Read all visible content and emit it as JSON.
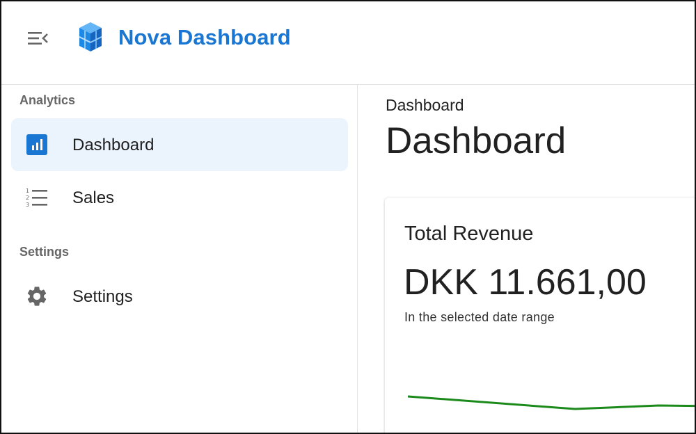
{
  "header": {
    "app_title": "Nova Dashboard",
    "menu_icon": "menu-open-icon",
    "logo_icon": "stacked-blocks-logo",
    "brand_color": "#1976d2"
  },
  "sidebar": {
    "sections": [
      {
        "title": "Analytics",
        "items": [
          {
            "label": "Dashboard",
            "icon": "bar-chart-icon",
            "active": true
          },
          {
            "label": "Sales",
            "icon": "numbered-list-icon",
            "active": false
          }
        ]
      },
      {
        "title": "Settings",
        "items": [
          {
            "label": "Settings",
            "icon": "gear-icon",
            "active": false
          }
        ]
      }
    ],
    "active_bg": "#ebf3fc"
  },
  "main": {
    "breadcrumb": "Dashboard",
    "title": "Dashboard",
    "card": {
      "title": "Total Revenue",
      "value": "DKK 11.661,00",
      "caption": "In the selected date range",
      "sparkline_color": "#1b8a1b"
    }
  }
}
